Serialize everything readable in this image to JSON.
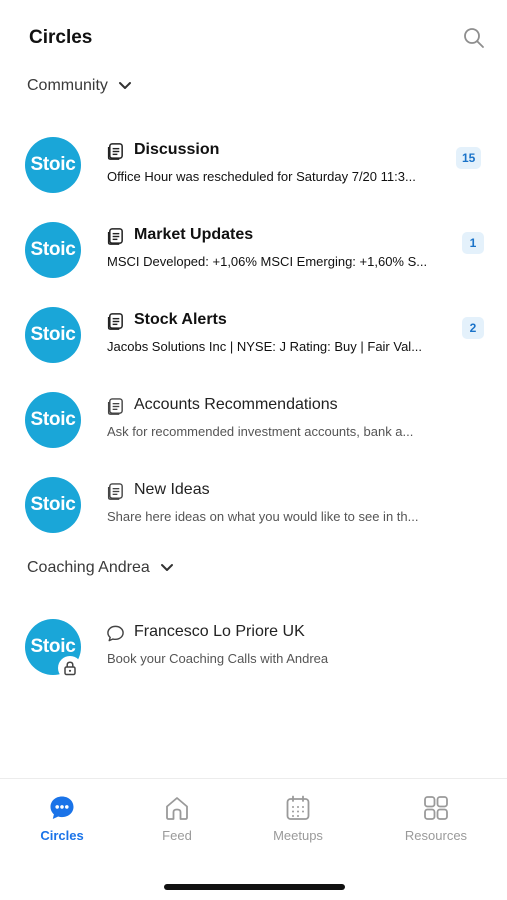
{
  "header": {
    "title": "Circles"
  },
  "sections": [
    {
      "label": "Community",
      "channels": [
        {
          "avatar_text": "Stoic",
          "icon": "article-icon",
          "title": "Discussion",
          "subtitle": "Office Hour was rescheduled for Saturday 7/20 11:3...",
          "badge": "15",
          "bold": true
        },
        {
          "avatar_text": "Stoic",
          "icon": "article-icon",
          "title": "Market Updates",
          "subtitle": "MSCI Developed: +1,06% MSCI Emerging: +1,60% S...",
          "badge": "1",
          "bold": true
        },
        {
          "avatar_text": "Stoic",
          "icon": "article-icon",
          "title": "Stock Alerts",
          "subtitle": "Jacobs Solutions Inc | NYSE: J Rating: Buy | Fair Val...",
          "badge": "2",
          "bold": true
        },
        {
          "avatar_text": "Stoic",
          "icon": "article-icon",
          "title": "Accounts Recommendations",
          "subtitle": "Ask for recommended investment accounts, bank a...",
          "badge": "",
          "bold": false
        },
        {
          "avatar_text": "Stoic",
          "icon": "article-icon",
          "title": "New Ideas",
          "subtitle": "Share here ideas on what you would like to see in th...",
          "badge": "",
          "bold": false
        }
      ]
    },
    {
      "label": "Coaching Andrea",
      "channels": [
        {
          "avatar_text": "Stoic",
          "icon": "chat-bubble-icon",
          "title": "Francesco Lo Priore UK",
          "subtitle": "Book your Coaching Calls with Andrea",
          "badge": "",
          "bold": false,
          "locked": true
        }
      ]
    }
  ],
  "tabs": [
    {
      "label": "Circles",
      "icon": "chat-bubble-dots-icon",
      "active": true
    },
    {
      "label": "Feed",
      "icon": "home-icon",
      "active": false
    },
    {
      "label": "Meetups",
      "icon": "calendar-icon",
      "active": false
    },
    {
      "label": "Resources",
      "icon": "grid-icon",
      "active": false
    }
  ],
  "colors": {
    "accent": "#1a73e8",
    "avatar": "#1aa6d8",
    "badge_bg": "#e4f1fb",
    "badge_text": "#1a73c9"
  }
}
